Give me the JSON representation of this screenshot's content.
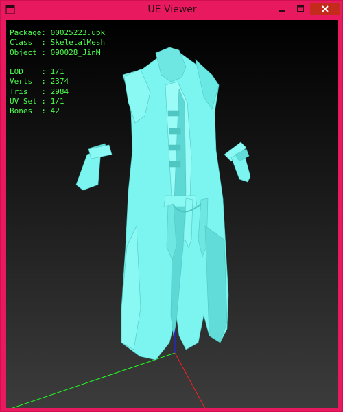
{
  "window": {
    "title": "UE Viewer",
    "accent_color": "#e8195f"
  },
  "controls": {
    "minimize_icon": "minimize-icon",
    "maximize_icon": "maximize-icon",
    "close_icon": "close-icon"
  },
  "info": {
    "package_label": "Package",
    "package_value": "00025223.upk",
    "class_label": "Class",
    "class_value": "SkeletalMesh",
    "object_label": "Object",
    "object_value": "090028_JinM",
    "lod_label": "LOD",
    "lod_value": "1/1",
    "verts_label": "Verts",
    "verts_value": "2374",
    "tris_label": "Tris",
    "tris_value": "2984",
    "uvset_label": "UV Set",
    "uvset_value": "1/1",
    "bones_label": "Bones",
    "bones_value": "42"
  },
  "scene": {
    "mesh_color": "#7cf5f0",
    "axis_x_color": "#ff2020",
    "axis_y_color": "#20ff20",
    "axis_z_color": "#2020ff"
  }
}
